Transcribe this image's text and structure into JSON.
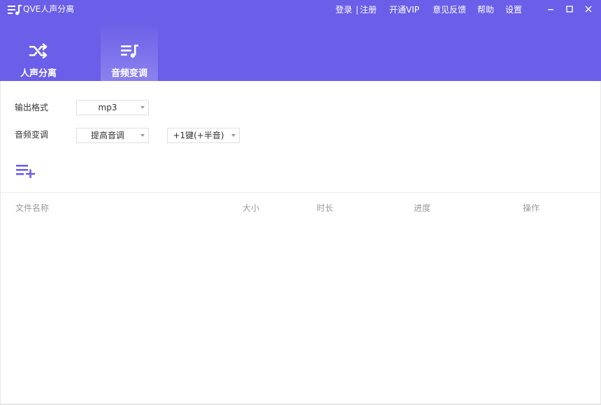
{
  "window": {
    "title": "QVE人声分离",
    "links": {
      "login": "登录",
      "separator": "|",
      "register": "注册",
      "vip": "开通VIP",
      "feedback": "意见反馈",
      "help": "帮助",
      "settings": "设置"
    },
    "controls": [
      "minimize-icon",
      "maximize-icon",
      "close-icon"
    ]
  },
  "tabs": [
    {
      "label": "人声分离",
      "icon": "shuffle-icon",
      "active": false
    },
    {
      "label": "音频变调",
      "icon": "music-list-icon",
      "active": true
    }
  ],
  "settings": {
    "output_format": {
      "label": "输出格式",
      "value": "mp3"
    },
    "pitch_shift": {
      "label": "音频变调",
      "mode_value": "提高音调",
      "amount_value": "+1键(+半音)"
    }
  },
  "toolbar": {
    "add_icon": "add-list-icon"
  },
  "table": {
    "columns": [
      "文件名称",
      "大小",
      "时长",
      "进度",
      "操作"
    ],
    "rows": []
  },
  "colors": {
    "header_bg": "#6b5ee8",
    "accent": "#6b5ee8"
  }
}
